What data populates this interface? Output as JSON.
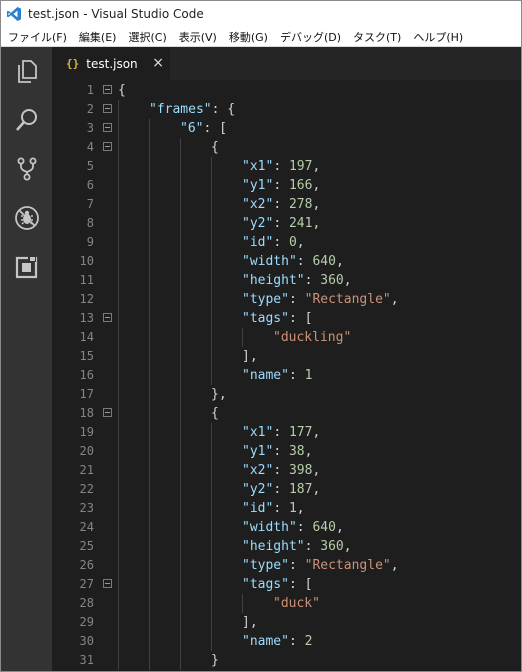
{
  "window": {
    "title": "test.json - Visual Studio Code"
  },
  "menu": [
    "ファイル(F)",
    "編集(E)",
    "選択(C)",
    "表示(V)",
    "移動(G)",
    "デバッグ(D)",
    "タスク(T)",
    "ヘルプ(H)"
  ],
  "activity_icons": [
    "files-icon",
    "search-icon",
    "source-control-icon",
    "debug-icon",
    "extensions-icon"
  ],
  "tab": {
    "label": "test.json",
    "icon": "{}",
    "close": "×"
  },
  "lines": [
    {
      "n": "1",
      "i": 0,
      "fold": true,
      "t": [
        {
          "c": "p",
          "v": "{"
        }
      ]
    },
    {
      "n": "2",
      "i": 1,
      "fold": true,
      "t": [
        {
          "c": "k",
          "v": "\"frames\""
        },
        {
          "c": "p",
          "v": ": {"
        }
      ]
    },
    {
      "n": "3",
      "i": 2,
      "fold": true,
      "t": [
        {
          "c": "k",
          "v": "\"6\""
        },
        {
          "c": "p",
          "v": ": ["
        }
      ]
    },
    {
      "n": "4",
      "i": 3,
      "fold": true,
      "t": [
        {
          "c": "p",
          "v": "{"
        }
      ]
    },
    {
      "n": "5",
      "i": 4,
      "fold": false,
      "t": [
        {
          "c": "k",
          "v": "\"x1\""
        },
        {
          "c": "p",
          "v": ": "
        },
        {
          "c": "n",
          "v": "197"
        },
        {
          "c": "p",
          "v": ","
        }
      ]
    },
    {
      "n": "6",
      "i": 4,
      "fold": false,
      "t": [
        {
          "c": "k",
          "v": "\"y1\""
        },
        {
          "c": "p",
          "v": ": "
        },
        {
          "c": "n",
          "v": "166"
        },
        {
          "c": "p",
          "v": ","
        }
      ]
    },
    {
      "n": "7",
      "i": 4,
      "fold": false,
      "t": [
        {
          "c": "k",
          "v": "\"x2\""
        },
        {
          "c": "p",
          "v": ": "
        },
        {
          "c": "n",
          "v": "278"
        },
        {
          "c": "p",
          "v": ","
        }
      ]
    },
    {
      "n": "8",
      "i": 4,
      "fold": false,
      "t": [
        {
          "c": "k",
          "v": "\"y2\""
        },
        {
          "c": "p",
          "v": ": "
        },
        {
          "c": "n",
          "v": "241"
        },
        {
          "c": "p",
          "v": ","
        }
      ]
    },
    {
      "n": "9",
      "i": 4,
      "fold": false,
      "t": [
        {
          "c": "k",
          "v": "\"id\""
        },
        {
          "c": "p",
          "v": ": "
        },
        {
          "c": "n",
          "v": "0"
        },
        {
          "c": "p",
          "v": ","
        }
      ]
    },
    {
      "n": "10",
      "i": 4,
      "fold": false,
      "t": [
        {
          "c": "k",
          "v": "\"width\""
        },
        {
          "c": "p",
          "v": ": "
        },
        {
          "c": "n",
          "v": "640"
        },
        {
          "c": "p",
          "v": ","
        }
      ]
    },
    {
      "n": "11",
      "i": 4,
      "fold": false,
      "t": [
        {
          "c": "k",
          "v": "\"height\""
        },
        {
          "c": "p",
          "v": ": "
        },
        {
          "c": "n",
          "v": "360"
        },
        {
          "c": "p",
          "v": ","
        }
      ]
    },
    {
      "n": "12",
      "i": 4,
      "fold": false,
      "t": [
        {
          "c": "k",
          "v": "\"type\""
        },
        {
          "c": "p",
          "v": ": "
        },
        {
          "c": "s",
          "v": "\"Rectangle\""
        },
        {
          "c": "p",
          "v": ","
        }
      ]
    },
    {
      "n": "13",
      "i": 4,
      "fold": true,
      "t": [
        {
          "c": "k",
          "v": "\"tags\""
        },
        {
          "c": "p",
          "v": ": ["
        }
      ]
    },
    {
      "n": "14",
      "i": 5,
      "fold": false,
      "t": [
        {
          "c": "s",
          "v": "\"duckling\""
        }
      ]
    },
    {
      "n": "15",
      "i": 4,
      "fold": false,
      "t": [
        {
          "c": "p",
          "v": "],"
        }
      ]
    },
    {
      "n": "16",
      "i": 4,
      "fold": false,
      "t": [
        {
          "c": "k",
          "v": "\"name\""
        },
        {
          "c": "p",
          "v": ": "
        },
        {
          "c": "n",
          "v": "1"
        }
      ]
    },
    {
      "n": "17",
      "i": 3,
      "fold": false,
      "t": [
        {
          "c": "p",
          "v": "},"
        }
      ]
    },
    {
      "n": "18",
      "i": 3,
      "fold": true,
      "t": [
        {
          "c": "p",
          "v": "{"
        }
      ]
    },
    {
      "n": "19",
      "i": 4,
      "fold": false,
      "t": [
        {
          "c": "k",
          "v": "\"x1\""
        },
        {
          "c": "p",
          "v": ": "
        },
        {
          "c": "n",
          "v": "177"
        },
        {
          "c": "p",
          "v": ","
        }
      ]
    },
    {
      "n": "20",
      "i": 4,
      "fold": false,
      "t": [
        {
          "c": "k",
          "v": "\"y1\""
        },
        {
          "c": "p",
          "v": ": "
        },
        {
          "c": "n",
          "v": "38"
        },
        {
          "c": "p",
          "v": ","
        }
      ]
    },
    {
      "n": "21",
      "i": 4,
      "fold": false,
      "t": [
        {
          "c": "k",
          "v": "\"x2\""
        },
        {
          "c": "p",
          "v": ": "
        },
        {
          "c": "n",
          "v": "398"
        },
        {
          "c": "p",
          "v": ","
        }
      ]
    },
    {
      "n": "22",
      "i": 4,
      "fold": false,
      "t": [
        {
          "c": "k",
          "v": "\"y2\""
        },
        {
          "c": "p",
          "v": ": "
        },
        {
          "c": "n",
          "v": "187"
        },
        {
          "c": "p",
          "v": ","
        }
      ]
    },
    {
      "n": "23",
      "i": 4,
      "fold": false,
      "t": [
        {
          "c": "k",
          "v": "\"id\""
        },
        {
          "c": "p",
          "v": ": "
        },
        {
          "c": "n",
          "v": "1"
        },
        {
          "c": "p",
          "v": ","
        }
      ]
    },
    {
      "n": "24",
      "i": 4,
      "fold": false,
      "t": [
        {
          "c": "k",
          "v": "\"width\""
        },
        {
          "c": "p",
          "v": ": "
        },
        {
          "c": "n",
          "v": "640"
        },
        {
          "c": "p",
          "v": ","
        }
      ]
    },
    {
      "n": "25",
      "i": 4,
      "fold": false,
      "t": [
        {
          "c": "k",
          "v": "\"height\""
        },
        {
          "c": "p",
          "v": ": "
        },
        {
          "c": "n",
          "v": "360"
        },
        {
          "c": "p",
          "v": ","
        }
      ]
    },
    {
      "n": "26",
      "i": 4,
      "fold": false,
      "t": [
        {
          "c": "k",
          "v": "\"type\""
        },
        {
          "c": "p",
          "v": ": "
        },
        {
          "c": "s",
          "v": "\"Rectangle\""
        },
        {
          "c": "p",
          "v": ","
        }
      ]
    },
    {
      "n": "27",
      "i": 4,
      "fold": true,
      "t": [
        {
          "c": "k",
          "v": "\"tags\""
        },
        {
          "c": "p",
          "v": ": ["
        }
      ]
    },
    {
      "n": "28",
      "i": 5,
      "fold": false,
      "t": [
        {
          "c": "s",
          "v": "\"duck\""
        }
      ]
    },
    {
      "n": "29",
      "i": 4,
      "fold": false,
      "t": [
        {
          "c": "p",
          "v": "],"
        }
      ]
    },
    {
      "n": "30",
      "i": 4,
      "fold": false,
      "t": [
        {
          "c": "k",
          "v": "\"name\""
        },
        {
          "c": "p",
          "v": ": "
        },
        {
          "c": "n",
          "v": "2"
        }
      ]
    },
    {
      "n": "31",
      "i": 3,
      "fold": false,
      "t": [
        {
          "c": "p",
          "v": "}"
        }
      ]
    }
  ]
}
